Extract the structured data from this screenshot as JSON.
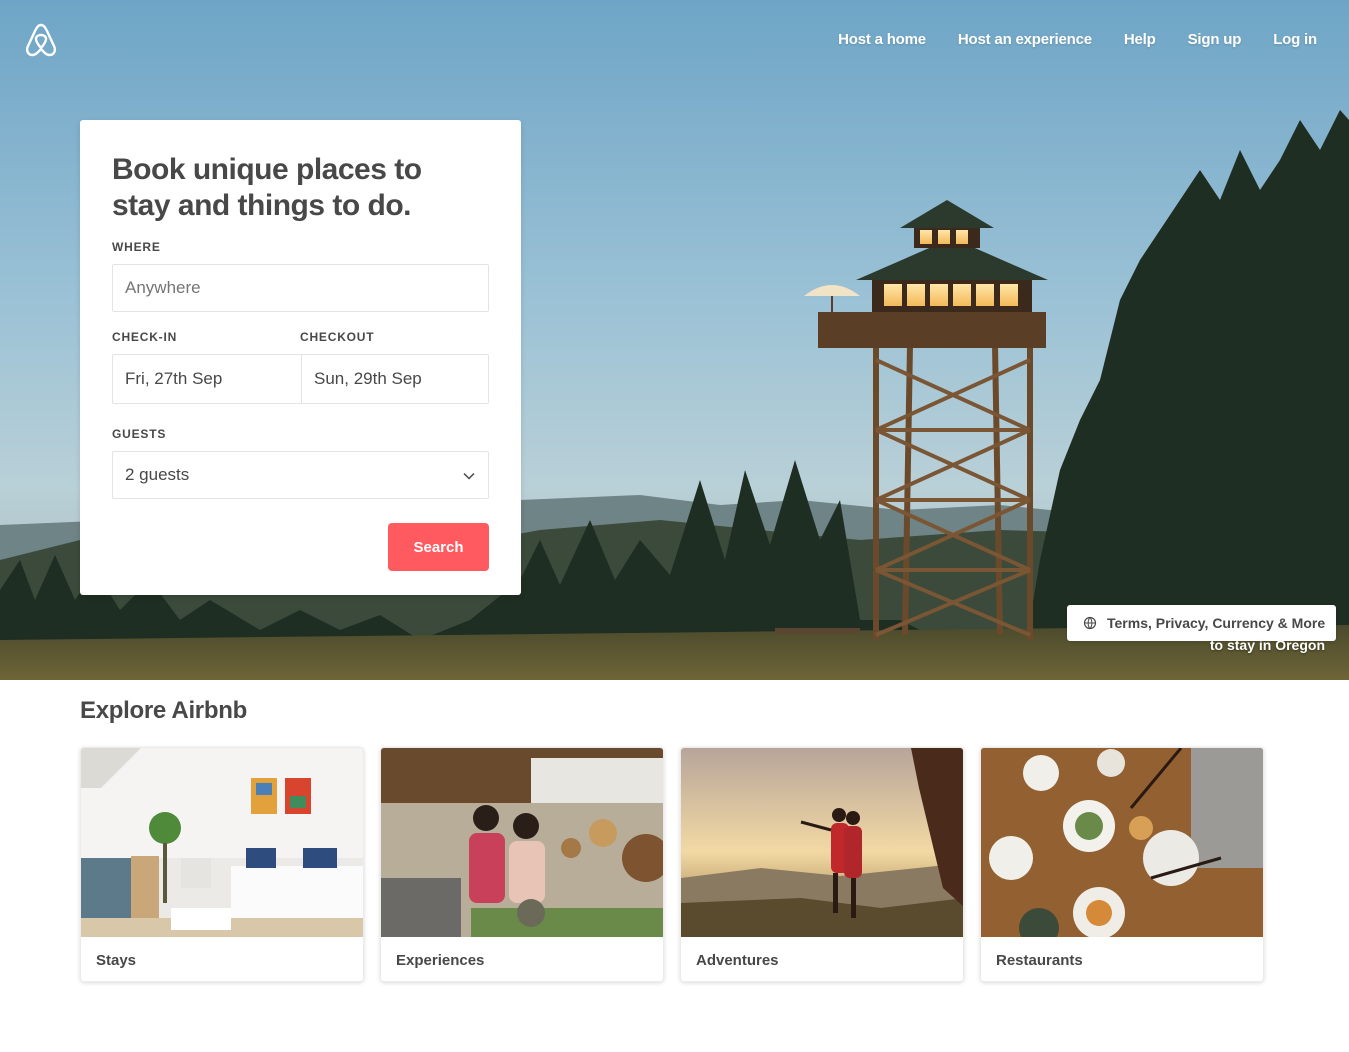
{
  "header": {
    "logo": "airbnb-logo",
    "nav": [
      "Host a home",
      "Host an experience",
      "Help",
      "Sign up",
      "Log in"
    ]
  },
  "search_card": {
    "title": "Book unique places to stay and things to do.",
    "where": {
      "label": "WHERE",
      "placeholder": "Anywhere",
      "value": ""
    },
    "checkin": {
      "label": "CHECK-IN",
      "value": "Fri, 27th Sep"
    },
    "checkout": {
      "label": "CHECKOUT",
      "value": "Sun, 29th Sep"
    },
    "guests": {
      "label": "GUESTS",
      "value": "2 guests"
    },
    "search_button": "Search"
  },
  "footer_pill": {
    "icon": "globe-icon",
    "label": "Terms, Privacy, Currency & More"
  },
  "hero_caption": "to stay in Oregon",
  "explore": {
    "title": "Explore Airbnb",
    "tiles": [
      {
        "label": "Stays"
      },
      {
        "label": "Experiences"
      },
      {
        "label": "Adventures"
      },
      {
        "label": "Restaurants"
      }
    ]
  },
  "colors": {
    "accent": "#ff5a5f",
    "text": "#484848",
    "border": "#e4e4e4"
  }
}
